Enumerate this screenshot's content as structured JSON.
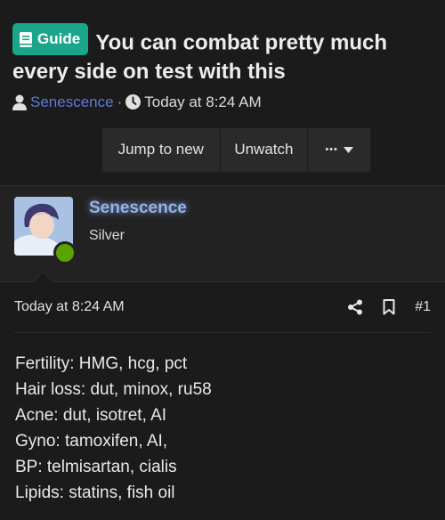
{
  "thread": {
    "prefix_label": "Guide",
    "title": "You can combat pretty much every side on test with this",
    "author": "Senescence",
    "separator": "·",
    "date": "Today at 8:24 AM"
  },
  "actions": {
    "jump_label": "Jump to new",
    "unwatch_label": "Unwatch",
    "more_label": "•••"
  },
  "user": {
    "name": "Senescence",
    "title": "Silver",
    "status": "online"
  },
  "post": {
    "date": "Today at 8:24 AM",
    "number": "#1",
    "lines": [
      "Fertility: HMG, hcg, pct",
      "Hair loss: dut, minox, ru58",
      "Acne: dut, isotret, AI",
      "Gyno: tamoxifen, AI,",
      "BP: telmisartan, cialis",
      "Lipids: statins, fish oil"
    ]
  },
  "colors": {
    "prefix_bg": "#1ba58a",
    "author_link": "#5c7bd6",
    "username_glow": "#93b2e6",
    "online_dot": "#5ba300"
  }
}
